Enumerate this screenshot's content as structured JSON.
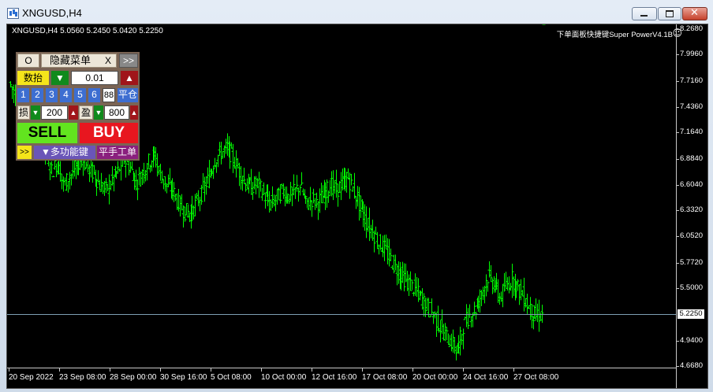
{
  "window": {
    "title": "XNGUSD,H4"
  },
  "chart": {
    "symbol_info": "XNGUSD,H4  5.0560 5.2450 5.0420 5.2250",
    "ea_name": "下单面板快捷键Super PowerV4.1B",
    "current_price": "5.2250",
    "price_ticks": [
      "8.2680",
      "7.9960",
      "7.7160",
      "7.4360",
      "7.1640",
      "6.8840",
      "6.6040",
      "6.3320",
      "6.0520",
      "5.7720",
      "5.5000",
      "5.2250",
      "4.9400",
      "4.6680"
    ],
    "time_ticks": [
      "20 Sep 2022",
      "23 Sep 08:00",
      "28 Sep 00:00",
      "30 Sep 16:00",
      "5 Oct 08:00",
      "10 Oct 00:00",
      "12 Oct 16:00",
      "17 Oct 08:00",
      "20 Oct 00:00",
      "24 Oct 16:00",
      "27 Oct 08:00"
    ],
    "colors": {
      "background": "#000000",
      "bars": "#00ff00",
      "price_line": "#7f9fb4",
      "axis_text": "#ffffff"
    }
  },
  "chart_data": {
    "type": "ohlc",
    "timeframe": "H4",
    "symbol": "XNGUSD",
    "ylim": [
      4.668,
      8.268
    ],
    "close_path": [
      7.7,
      7.55,
      7.62,
      7.4,
      7.2,
      7.05,
      6.95,
      6.75,
      6.85,
      6.6,
      6.7,
      6.8,
      6.9,
      6.78,
      6.72,
      6.6,
      6.55,
      6.66,
      6.75,
      6.88,
      6.78,
      6.62,
      6.74,
      6.85,
      6.92,
      6.7,
      6.6,
      6.55,
      6.4,
      6.32,
      6.3,
      6.42,
      6.55,
      6.7,
      6.88,
      6.95,
      7.0,
      6.88,
      6.75,
      6.62,
      6.58,
      6.62,
      6.5,
      6.4,
      6.45,
      6.55,
      6.48,
      6.52,
      6.6,
      6.4,
      6.45,
      6.42,
      6.5,
      6.6,
      6.55,
      6.62,
      6.68,
      6.52,
      6.36,
      6.2,
      6.1,
      5.98,
      5.92,
      5.8,
      5.7,
      5.62,
      5.55,
      5.48,
      5.4,
      5.3,
      5.22,
      5.1,
      5.0,
      4.92,
      4.82,
      5.1,
      5.22,
      5.28,
      5.45,
      5.62,
      5.55,
      5.4,
      5.52,
      5.6,
      5.5,
      5.4,
      5.25,
      5.2,
      5.22
    ],
    "last_bar": {
      "open": 5.056,
      "high": 5.245,
      "low": 5.042,
      "close": 5.225
    }
  },
  "ea_panel": {
    "toggle_o": "O",
    "hide_menu": "隐藏菜单",
    "close_x": "X",
    "expand": ">>",
    "lots_label": "数抬",
    "lots_down": "▼",
    "lots_value": "0.01",
    "lots_up": "▲",
    "quick_lots": [
      "1",
      "2",
      "3",
      "4",
      "5",
      "6"
    ],
    "magic_value": "88",
    "close_position": "平仓",
    "sl_label": "损",
    "sl_down": "▼",
    "sl_value": "200",
    "sl_up": "▲",
    "tp_label": "盈",
    "tp_down": "▼",
    "tp_value": "800",
    "tp_up": "▲",
    "sell": "SELL",
    "buy": "BUY",
    "more_expand": ">>",
    "multi_function": "▼多功能键",
    "manual_close": "平手工单"
  }
}
